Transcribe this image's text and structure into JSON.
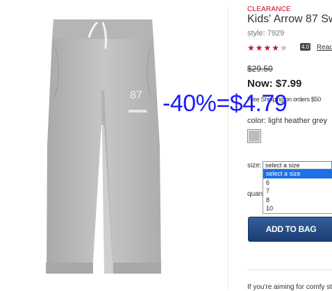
{
  "product": {
    "clearance_tag": "CLEARANCE",
    "title": "Kids' Arrow 87 Sw",
    "style": "style: 7929",
    "rating": {
      "value": 4.0,
      "max": 5,
      "badge": "4.0"
    },
    "reviews_link": "Read",
    "original_price": "$29.50",
    "now_price": "Now: $7.99",
    "shipping_note": "Free Shipping on orders $50",
    "image_print_text": "87"
  },
  "overlay": {
    "text": "-40%=$4.79"
  },
  "color": {
    "label": "color: light heather grey",
    "swatch_hex": "#bdbdbd"
  },
  "size": {
    "label": "size:",
    "selected": "select a size",
    "options": [
      "select a size",
      "6",
      "7",
      "8",
      "10"
    ]
  },
  "quantity": {
    "label": "quan"
  },
  "actions": {
    "add_to_bag": "ADD TO BAG"
  },
  "description": {
    "teaser": "If you're aiming for comfy sty"
  },
  "colors": {
    "accent_red": "#c8102e",
    "button_blue": "#1d3c73",
    "overlay_blue": "#1a1aff"
  }
}
